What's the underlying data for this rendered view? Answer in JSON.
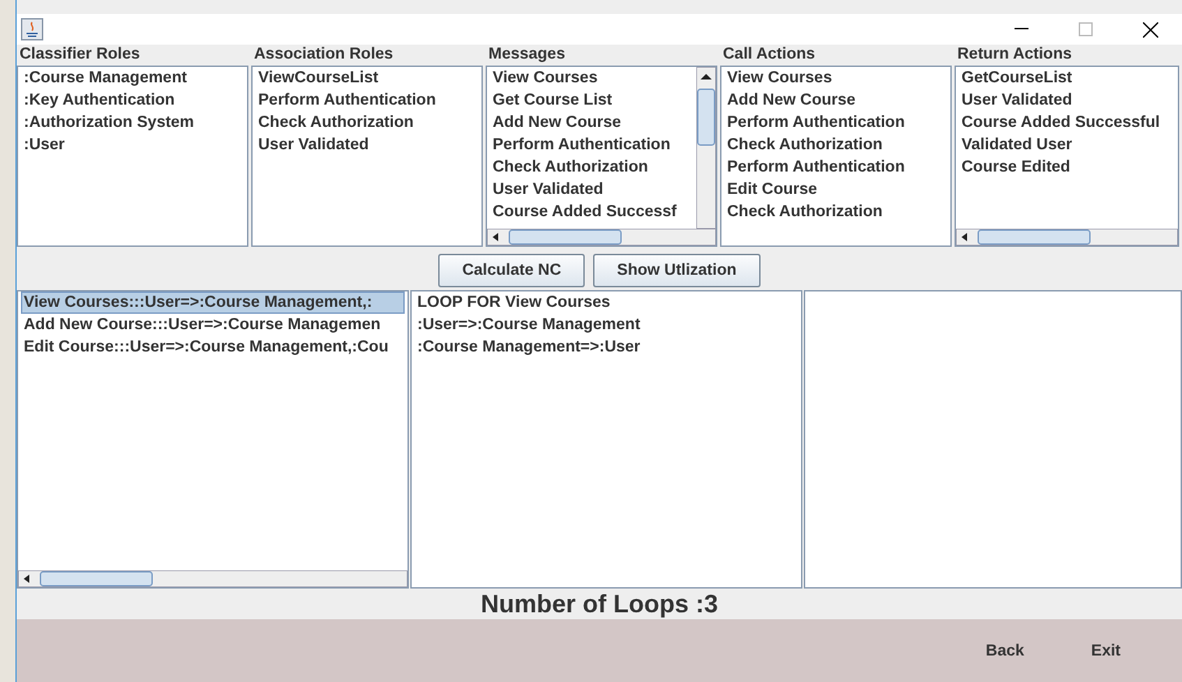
{
  "columns": [
    {
      "title": "Classifier Roles",
      "kind": "plain",
      "items": [
        ":Course Management",
        ":Key Authentication",
        ":Authorization System",
        ":User"
      ]
    },
    {
      "title": "Association Roles",
      "kind": "plain",
      "items": [
        "ViewCourseList",
        "Perform Authentication",
        "Check Authorization",
        "User Validated"
      ]
    },
    {
      "title": "Messages",
      "kind": "scrollable",
      "items": [
        "View Courses",
        "Get Course List",
        "Add New Course",
        "Perform Authentication",
        "Check Authorization",
        "User Validated",
        "Course Added Successf"
      ]
    },
    {
      "title": "Call Actions",
      "kind": "plain",
      "items": [
        "View Courses",
        "Add New Course",
        "Perform Authentication",
        "Check Authorization",
        "Perform Authentication",
        "Edit Course",
        "Check Authorization"
      ]
    },
    {
      "title": "Return Actions",
      "kind": "wide",
      "items": [
        "GetCourseList",
        "User Validated",
        "Course Added Successful",
        "Validated User",
        "Course Edited"
      ]
    }
  ],
  "buttons": [
    "Calculate NC",
    "Show Utlization"
  ],
  "scenarios": [
    {
      "label": "View Courses:::User=>:Course Management,:",
      "selected": true
    },
    {
      "label": "Add New Course:::User=>:Course Managemen",
      "selected": false
    },
    {
      "label": "Edit Course:::User=>:Course Management,:Cou",
      "selected": false
    }
  ],
  "loop_details": [
    "LOOP FOR View Courses",
    ":User=>:Course Management",
    ":Course Management=>:User"
  ],
  "loop_count": "Number of Loops :3",
  "footer_buttons": [
    "Back",
    "Exit"
  ]
}
